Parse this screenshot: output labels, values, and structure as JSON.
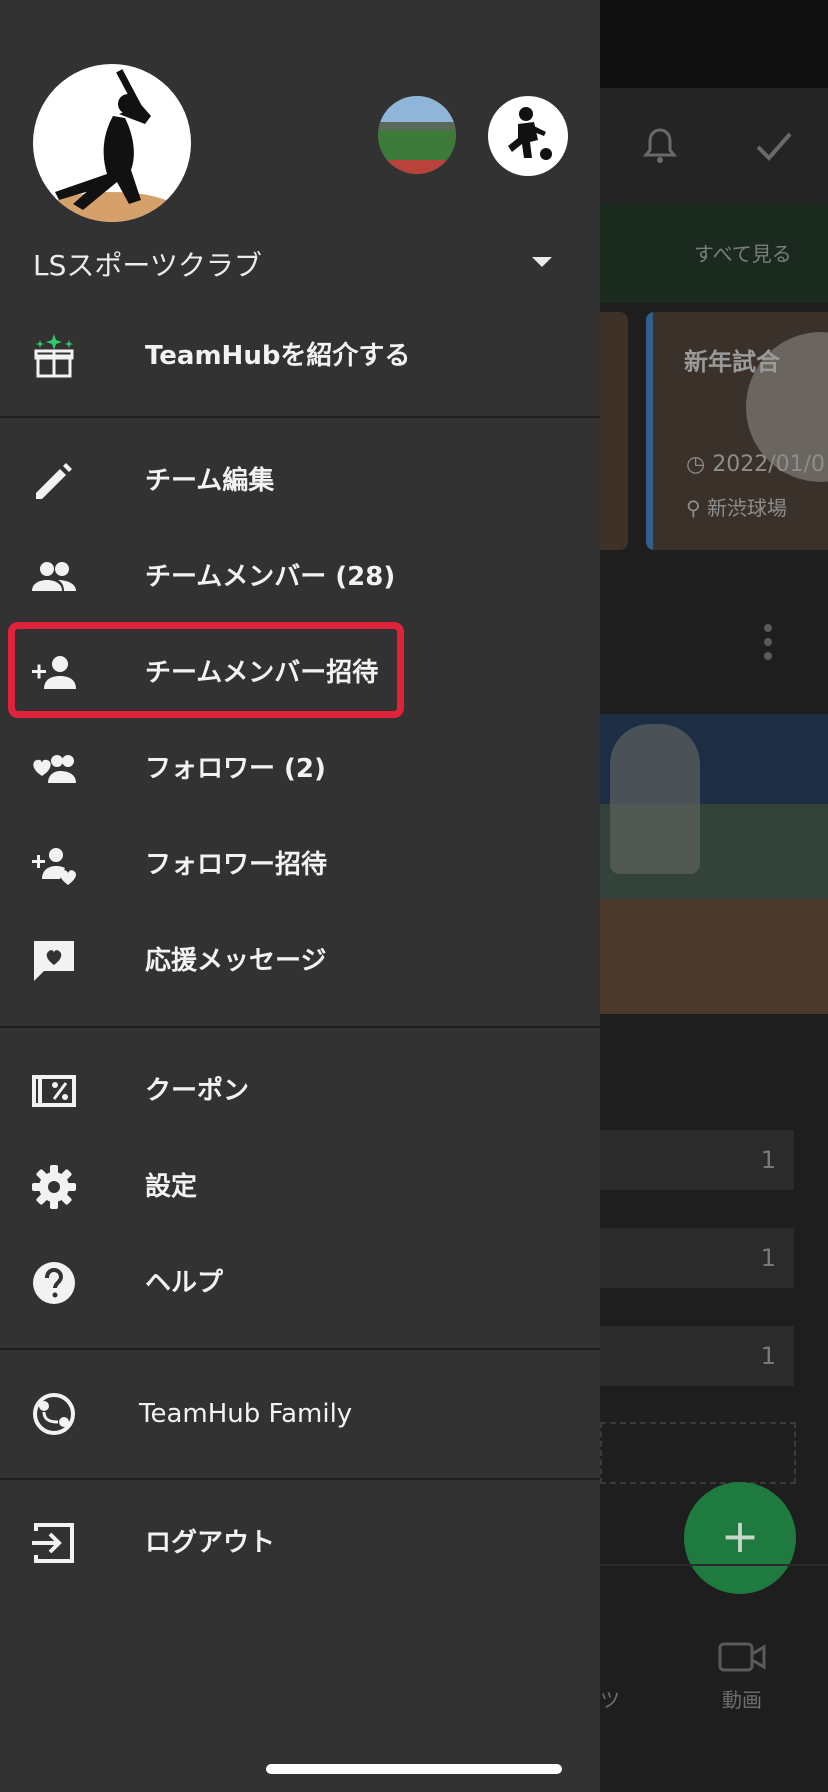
{
  "background": {
    "see_all_label": "すべて見る",
    "event_card": {
      "title": "新年試合",
      "date": "2022/01/0",
      "place": "新渋球場"
    },
    "counts": [
      "1",
      "1",
      "1"
    ],
    "fab_symbol": "+",
    "nav_labels": [
      "ツ",
      "動画"
    ]
  },
  "drawer": {
    "team_name": "LSスポーツクラブ",
    "avatars": {
      "main_icon": "baseball-batter-icon",
      "small_1": "stadium-photo",
      "small_2": "soccer-player-icon"
    },
    "promo": {
      "label": "TeamHubを紹介する",
      "icon": "gift-icon",
      "accent": "#2ecc71"
    },
    "team_section": [
      {
        "label": "チーム編集",
        "icon": "pencil-icon"
      },
      {
        "label": "チームメンバー (28)",
        "icon": "people-icon"
      },
      {
        "label": "チームメンバー招待",
        "icon": "person-add-icon"
      },
      {
        "label": "フォロワー (2)",
        "icon": "heart-people-icon"
      },
      {
        "label": "フォロワー招待",
        "icon": "person-add-heart-icon"
      },
      {
        "label": "応援メッセージ",
        "icon": "heart-message-icon"
      }
    ],
    "misc_section": [
      {
        "label": "クーポン",
        "icon": "coupon-icon"
      },
      {
        "label": "設定",
        "icon": "gear-icon"
      },
      {
        "label": "ヘルプ",
        "icon": "help-icon"
      }
    ],
    "family": {
      "label": "TeamHub Family",
      "icon": "family-icon"
    },
    "logout": {
      "label": "ログアウト",
      "icon": "logout-icon"
    },
    "highlight_color": "#e0233a"
  }
}
